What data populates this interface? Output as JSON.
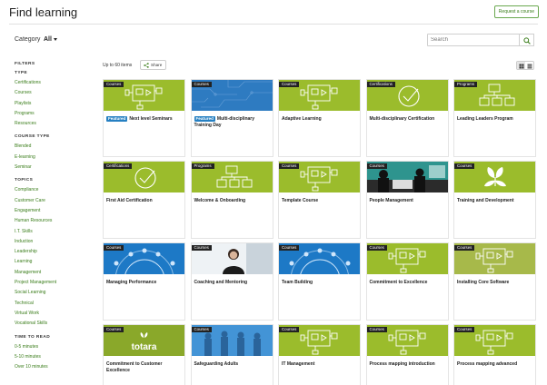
{
  "header": {
    "title": "Find learning",
    "request_label": "Request a course"
  },
  "category": {
    "label": "Category",
    "value": "All"
  },
  "search": {
    "placeholder": "Search"
  },
  "filters": {
    "heading": "FILTERS",
    "groups": [
      {
        "heading": "TYPE",
        "items": [
          "Certifications",
          "Courses",
          "Playlists",
          "Programs",
          "Resources"
        ]
      },
      {
        "heading": "COURSE TYPE",
        "items": [
          "Blended",
          "E-learning",
          "Seminar"
        ]
      },
      {
        "heading": "TOPICS",
        "items": [
          "Compliance",
          "Customer Care",
          "Engagement",
          "Human Resources",
          "I.T. Skills",
          "Induction",
          "Leadership",
          "Learning",
          "Management",
          "Project Management",
          "Social Learning",
          "Technical",
          "Virtual Work",
          "Vocational Skills"
        ]
      },
      {
        "heading": "TIME TO READ",
        "items": [
          "0-5 minutes",
          "5-10 minutes",
          "Over 10 minutes"
        ]
      }
    ]
  },
  "results": {
    "count_label": "Up to 60 items",
    "share_label": "Share"
  },
  "colors": {
    "accent": "#3a7d1a",
    "card_green": "#9bbc2c",
    "card_blue": "#1d79c6",
    "featured": "#2680c2"
  },
  "cards": [
    {
      "tag": "Courses",
      "title": "Next level Seminars",
      "featured": "Featured",
      "image": "green-screen-icon"
    },
    {
      "tag": "Courses",
      "title": "Multi-disciplinary Training Day",
      "featured": "Featured",
      "image": "blue-circuit-photo"
    },
    {
      "tag": "Courses",
      "title": "Adaptive Learning",
      "image": "green-screen-icon"
    },
    {
      "tag": "Certifications",
      "title": "Multi-disciplinary Certification",
      "image": "green-check-icon"
    },
    {
      "tag": "Programs",
      "title": "Leading Leaders Program",
      "image": "green-org-chart-icon"
    },
    {
      "tag": "Certifications",
      "title": "First Aid Certification",
      "image": "green-check-icon"
    },
    {
      "tag": "Programs",
      "title": "Welcome & Onboarding",
      "image": "green-org-chart-icon"
    },
    {
      "tag": "Courses",
      "title": "Template Course",
      "image": "green-screen-icon"
    },
    {
      "tag": "Courses",
      "title": "People Management",
      "image": "teal-office-photo"
    },
    {
      "tag": "Courses",
      "title": "Training and Development",
      "image": "green-sprout-icon"
    },
    {
      "tag": "Courses",
      "title": "Managing Performance",
      "image": "blue-people-circle"
    },
    {
      "tag": "Courses",
      "title": "Coaching and Mentoring",
      "image": "person-photo"
    },
    {
      "tag": "Courses",
      "title": "Team Building",
      "image": "blue-people-circle"
    },
    {
      "tag": "Courses",
      "title": "Commitment to Excellence",
      "image": "green-screen-icon"
    },
    {
      "tag": "Courses",
      "title": "Installing Core Software",
      "image": "grey-screen-icon"
    },
    {
      "tag": "Courses",
      "title": "Commitment to Customer Excellence",
      "image": "totara-logo",
      "logo_text": "totara"
    },
    {
      "tag": "Courses",
      "title": "Safeguarding Adults",
      "image": "blue-team-photo"
    },
    {
      "tag": "Courses",
      "title": "IT Management",
      "image": "green-screen-icon"
    },
    {
      "tag": "Courses",
      "title": "Process mapping introduction",
      "image": "green-screen-icon"
    },
    {
      "tag": "Courses",
      "title": "Process mapping advanced",
      "image": "green-screen-icon"
    }
  ]
}
